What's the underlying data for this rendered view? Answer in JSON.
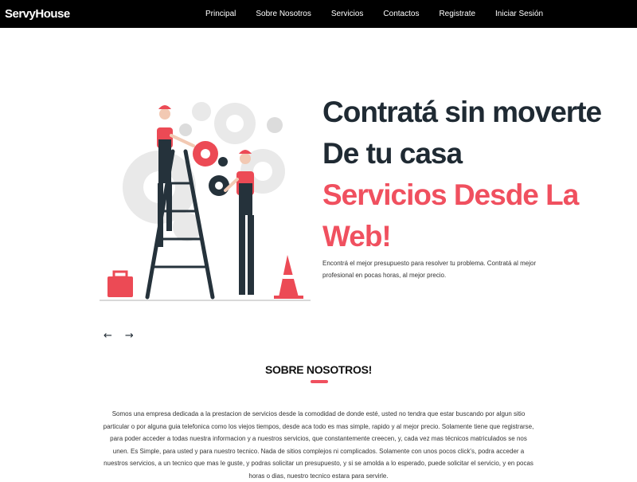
{
  "navbar": {
    "brand": "ServyHouse",
    "links": [
      "Principal",
      "Sobre Nosotros",
      "Servicios",
      "Contactos",
      "Registrate",
      "Iniciar Sesión"
    ]
  },
  "hero": {
    "headline_line1": "Contratá sin moverte",
    "headline_line2": "De tu casa",
    "headline_accent1": "Servicios Desde La",
    "headline_accent2": "Web!",
    "lead": "Encontrá el mejor presupuesto para resolver tu problema. Contratá al mejor profesional en pocas horas, al mejor precio.",
    "illustration_icon": "workers-ladder-gears-illustration",
    "prev_arrow": "←",
    "next_arrow": "→"
  },
  "about": {
    "title": "SOBRE NOSOTROS!",
    "text": "Somos una empresa dedicada a la prestacion de servicios desde la comodidad de donde esté, usted no tendra que estar buscando por algun sitio particular o por alguna guia telefonica como los viejos tiempos, desde aca todo es mas simple, rapido y al mejor precio. Solamente tiene que registrarse, para poder acceder a todas nuestra informacion y a nuestros servicios, que constantemente creecen, y, cada vez mas técnicos matriculados se nos unen. Es Simple, para usted y para nuestro tecnico. Nada de sitios complejos ni complicados. Solamente con unos pocos click's, podra acceder a nuestros servicios, a un tecnico que mas le guste, y podras solicitar un presupuesto, y si se amolda a lo esperado, puede solicitar el servicio, y en pocas horas o dias, nuestro tecnico estara para servirle."
  },
  "colors": {
    "accent": "#f0505f",
    "dark": "#1f2a33",
    "navbar_bg": "#000000"
  }
}
